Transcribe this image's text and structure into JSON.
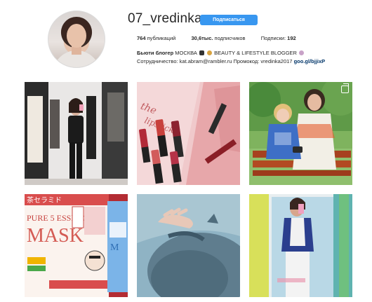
{
  "profile": {
    "username": "07_vredinka",
    "follow_label": "Подписаться",
    "posts_count": "764",
    "posts_label": "публикаций",
    "followers_count": "30,6тыс.",
    "followers_label": "подписчиков",
    "following_label": "Подписки:",
    "following_count": "192",
    "bio_name": "Бьюти блогер",
    "bio_line1": "МОСКВА",
    "bio_line1_tail": "BEAUTY & LIFESTYLE BLOGGER",
    "bio_line2": "Сотрудничество: kat.abram@rambler.ru Промокод: vredinka2017",
    "bio_link": "goo.gl/bjjixP"
  },
  "posts": [
    {
      "name": "post-store-mirror-selfie",
      "multi": false
    },
    {
      "name": "post-lipsticks",
      "multi": false
    },
    {
      "name": "post-mother-daughter-bench",
      "multi": true
    },
    {
      "name": "post-mask-packages",
      "multi": false
    },
    {
      "name": "post-cat-hand",
      "multi": false
    },
    {
      "name": "post-mirror-selfie-blue",
      "multi": false
    }
  ],
  "colors": {
    "follow_button": "#3897f0",
    "link": "#003569"
  }
}
